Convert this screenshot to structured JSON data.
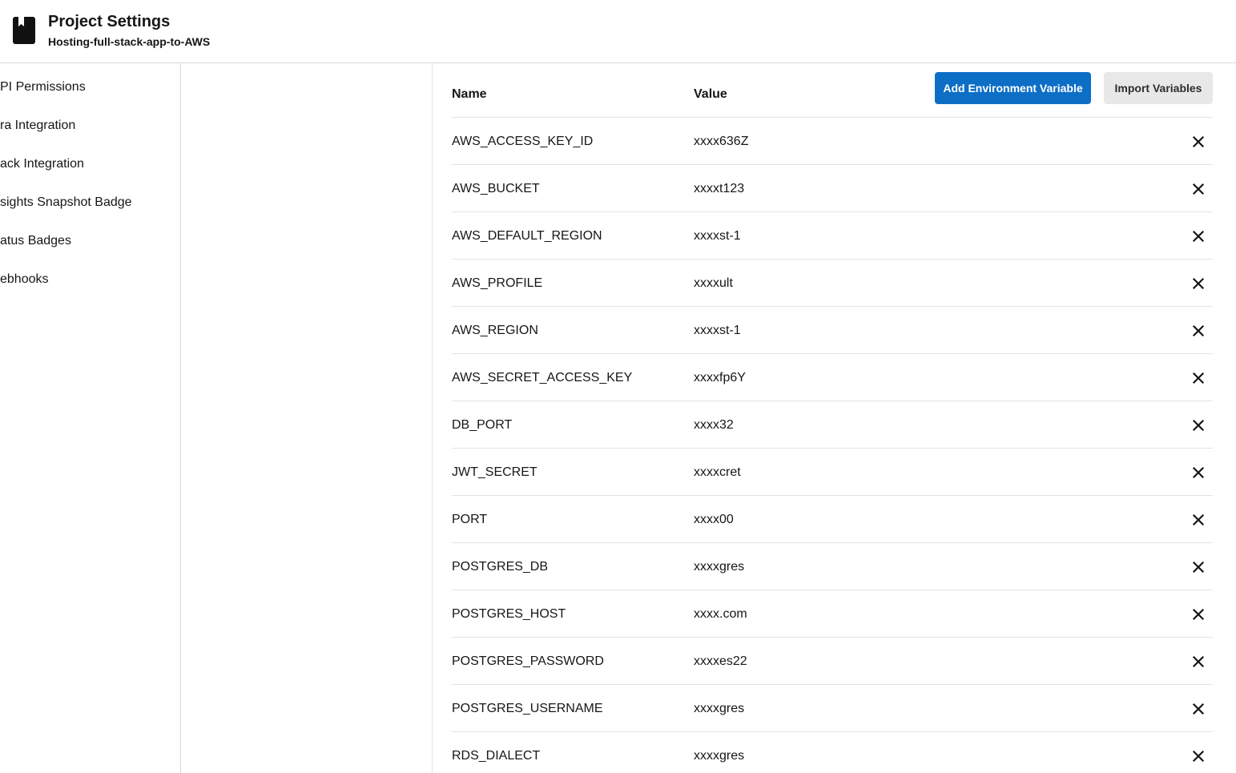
{
  "header": {
    "title": "Project Settings",
    "subtitle": "Hosting-full-stack-app-to-AWS",
    "icon": "book-icon"
  },
  "sidebar": {
    "items": [
      {
        "label": "PI Permissions"
      },
      {
        "label": "ra Integration"
      },
      {
        "label": "ack Integration"
      },
      {
        "label": "sights Snapshot Badge"
      },
      {
        "label": "atus Badges"
      },
      {
        "label": "ebhooks"
      }
    ]
  },
  "env_table": {
    "col_name": "Name",
    "col_value": "Value",
    "add_button": "Add Environment Variable",
    "import_button": "Import Variables",
    "delete_icon": "close-icon",
    "rows": [
      {
        "name": "AWS_ACCESS_KEY_ID",
        "value": "xxxx636Z"
      },
      {
        "name": "AWS_BUCKET",
        "value": "xxxxt123"
      },
      {
        "name": "AWS_DEFAULT_REGION",
        "value": "xxxxst-1"
      },
      {
        "name": "AWS_PROFILE",
        "value": "xxxxult"
      },
      {
        "name": "AWS_REGION",
        "value": "xxxxst-1"
      },
      {
        "name": "AWS_SECRET_ACCESS_KEY",
        "value": "xxxxfp6Y"
      },
      {
        "name": "DB_PORT",
        "value": "xxxx32"
      },
      {
        "name": "JWT_SECRET",
        "value": "xxxxcret"
      },
      {
        "name": "PORT",
        "value": "xxxx00"
      },
      {
        "name": "POSTGRES_DB",
        "value": "xxxxgres"
      },
      {
        "name": "POSTGRES_HOST",
        "value": "xxxx.com"
      },
      {
        "name": "POSTGRES_PASSWORD",
        "value": "xxxxes22"
      },
      {
        "name": "POSTGRES_USERNAME",
        "value": "xxxxgres"
      },
      {
        "name": "RDS_DIALECT",
        "value": "xxxxgres"
      }
    ]
  },
  "colors": {
    "primary": "#0d6ec6",
    "secondary_button": "#e8e8e8",
    "divider": "#e3e3e3"
  }
}
